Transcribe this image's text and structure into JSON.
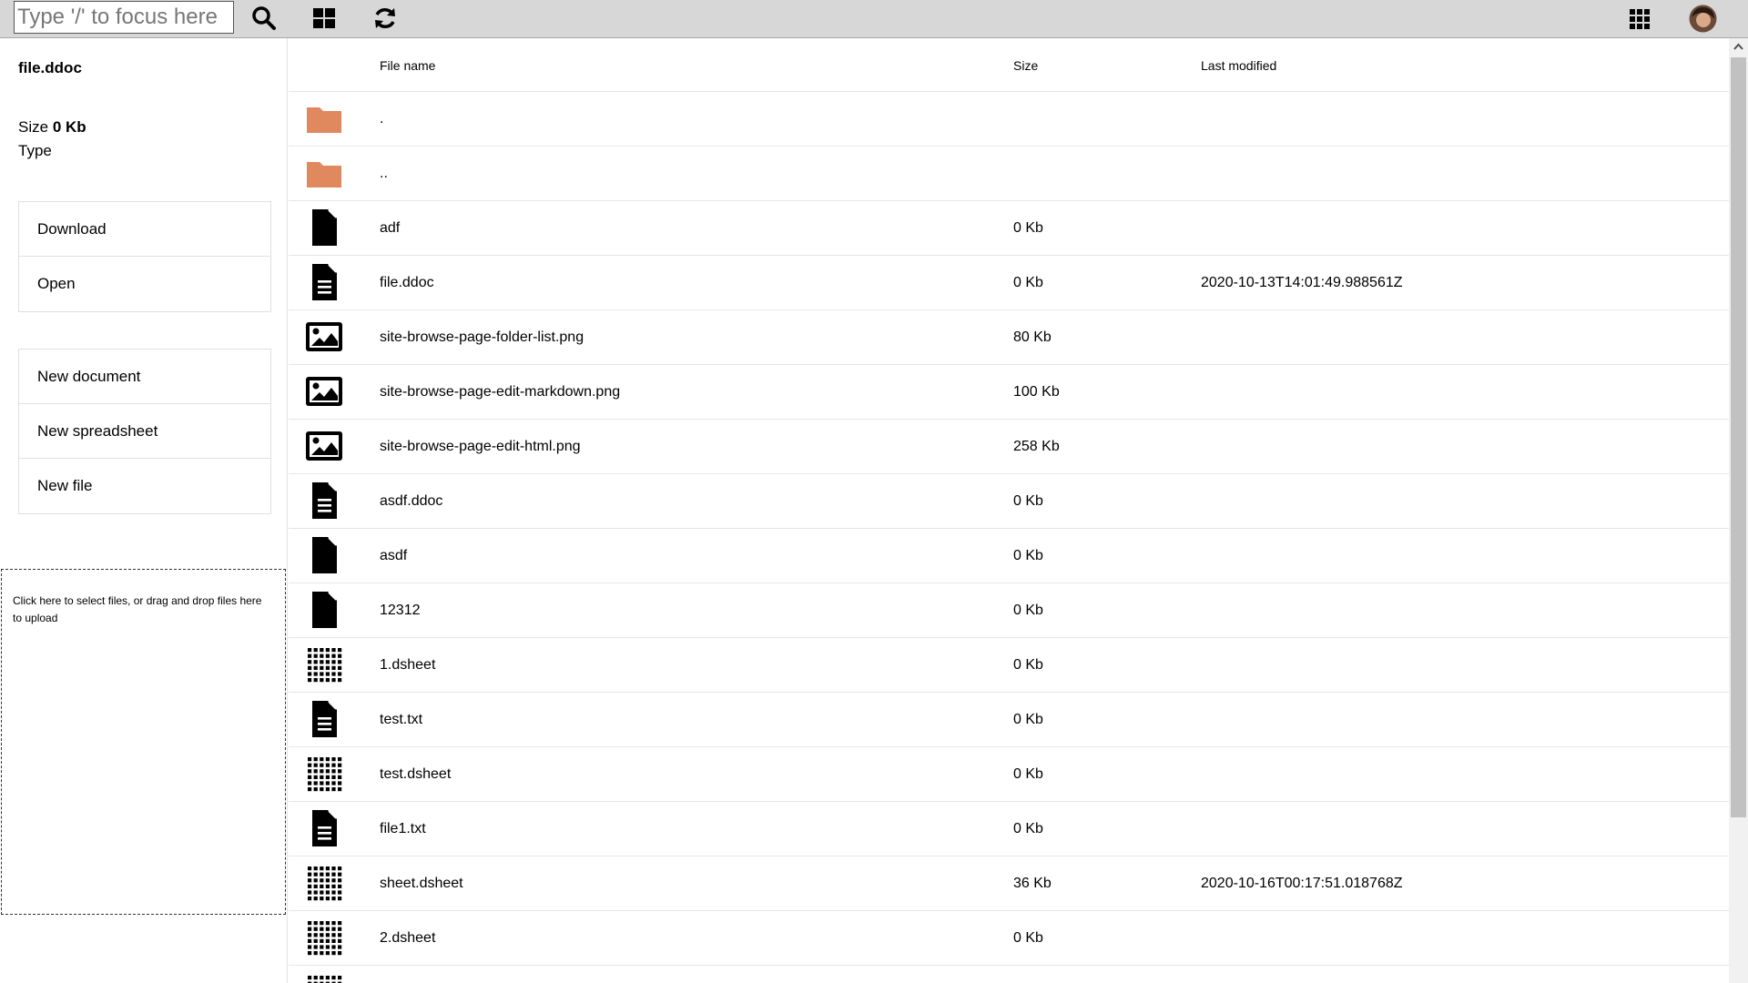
{
  "topbar": {
    "search_placeholder": "Type '/' to focus here",
    "icons": [
      "search-icon",
      "grid-view-icon",
      "refresh-icon",
      "apps-grid-icon",
      "avatar"
    ]
  },
  "sidebar": {
    "selected_name": "file.ddoc",
    "size_label": "Size",
    "size_value": "0 Kb",
    "type_label": "Type",
    "actions": [
      "Download",
      "Open"
    ],
    "create": [
      "New document",
      "New spreadsheet",
      "New file"
    ],
    "upload_text": "Click here to select files, or drag and drop files here to upload"
  },
  "table": {
    "headers": {
      "name": "File name",
      "size": "Size",
      "modified": "Last modified"
    },
    "rows": [
      {
        "icon": "folder-icon",
        "name": ".",
        "size": "",
        "modified": ""
      },
      {
        "icon": "folder-icon",
        "name": "..",
        "size": "",
        "modified": ""
      },
      {
        "icon": "file-icon",
        "name": "adf",
        "size": "0 Kb",
        "modified": ""
      },
      {
        "icon": "document-icon",
        "name": "file.ddoc",
        "size": "0 Kb",
        "modified": "2020-10-13T14:01:49.988561Z"
      },
      {
        "icon": "image-icon",
        "name": "site-browse-page-folder-list.png",
        "size": "80 Kb",
        "modified": ""
      },
      {
        "icon": "image-icon",
        "name": "site-browse-page-edit-markdown.png",
        "size": "100 Kb",
        "modified": ""
      },
      {
        "icon": "image-icon",
        "name": "site-browse-page-edit-html.png",
        "size": "258 Kb",
        "modified": ""
      },
      {
        "icon": "document-icon",
        "name": "asdf.ddoc",
        "size": "0 Kb",
        "modified": ""
      },
      {
        "icon": "file-icon",
        "name": "asdf",
        "size": "0 Kb",
        "modified": ""
      },
      {
        "icon": "file-icon",
        "name": "12312",
        "size": "0 Kb",
        "modified": ""
      },
      {
        "icon": "spreadsheet-icon",
        "name": "1.dsheet",
        "size": "0 Kb",
        "modified": ""
      },
      {
        "icon": "document-icon",
        "name": "test.txt",
        "size": "0 Kb",
        "modified": ""
      },
      {
        "icon": "spreadsheet-icon",
        "name": "test.dsheet",
        "size": "0 Kb",
        "modified": ""
      },
      {
        "icon": "document-icon",
        "name": "file1.txt",
        "size": "0 Kb",
        "modified": ""
      },
      {
        "icon": "spreadsheet-icon",
        "name": "sheet.dsheet",
        "size": "36 Kb",
        "modified": "2020-10-16T00:17:51.018768Z"
      },
      {
        "icon": "spreadsheet-icon",
        "name": "2.dsheet",
        "size": "0 Kb",
        "modified": ""
      },
      {
        "icon": "spreadsheet-icon",
        "name": "",
        "size": "",
        "modified": ""
      }
    ]
  },
  "colors": {
    "folder": "#e0895e",
    "topbar": "#d7d7d7"
  }
}
